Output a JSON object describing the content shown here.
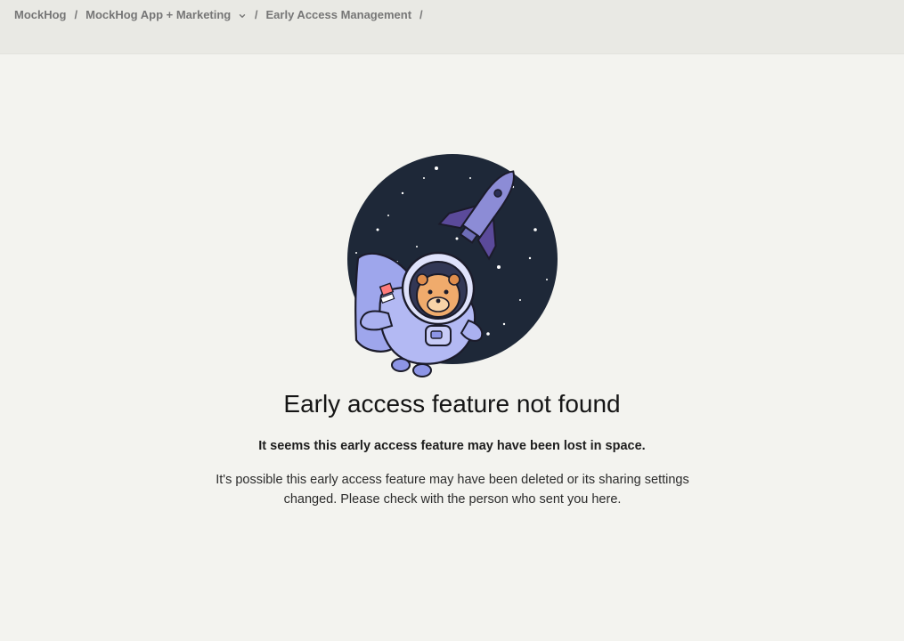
{
  "breadcrumb": {
    "items": [
      {
        "label": "MockHog"
      },
      {
        "label": "MockHog App + Marketing"
      },
      {
        "label": "Early Access Management"
      }
    ],
    "separator": "/"
  },
  "icons": {
    "project_switch": "chevron-down-icon",
    "illustration": "astronaut-hedgehog-space-illustration"
  },
  "colors": {
    "page_background": "#f3f3ef",
    "topbar_background": "#e9e9e4",
    "space_circle": "#1e2838",
    "astronaut_suit": "#aab1f0"
  },
  "empty_state": {
    "title": "Early access feature not found",
    "subtitle": "It seems this early access feature may have been lost in space.",
    "description": "It's possible this early access feature may have been deleted or its sharing settings changed. Please check with the person who sent you here."
  }
}
